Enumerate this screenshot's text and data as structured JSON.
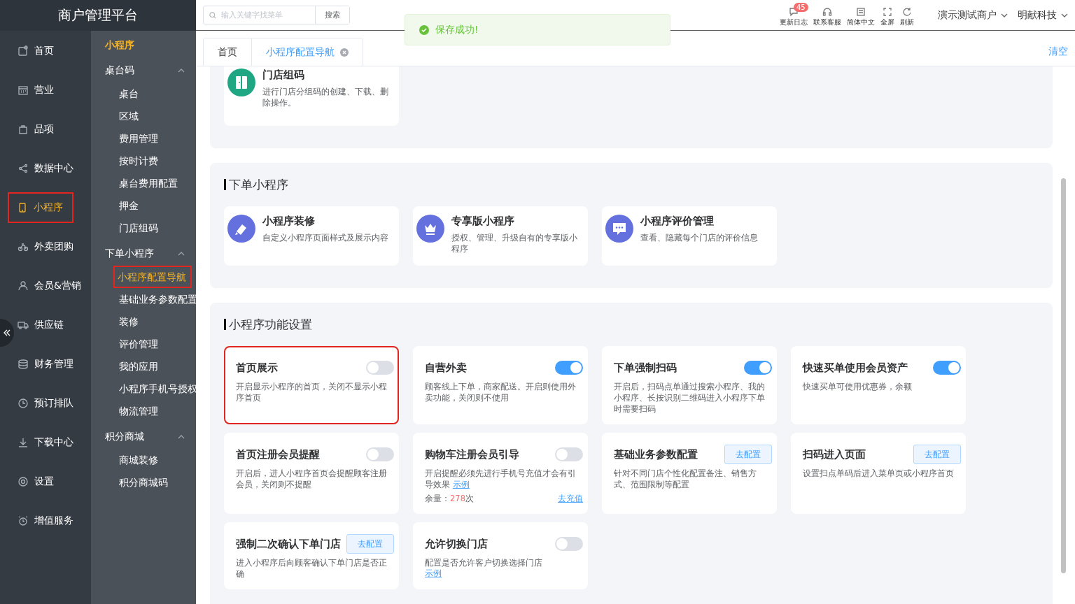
{
  "brand": {
    "title": "商户管理平台"
  },
  "search": {
    "placeholder": "输入关键字找菜单",
    "button": "搜索"
  },
  "toast": {
    "message": "保存成功!"
  },
  "tools": [
    {
      "label": "更新日志",
      "badge": "45"
    },
    {
      "label": "联系客服"
    },
    {
      "label": "简体中文"
    },
    {
      "label": "全屏"
    },
    {
      "label": "刷新"
    }
  ],
  "account_menus": [
    "演示测试商户",
    "明献科技"
  ],
  "nav": {
    "items": [
      {
        "label": "首页",
        "selected": false,
        "highlighted": false
      },
      {
        "label": "营业",
        "selected": false,
        "highlighted": false
      },
      {
        "label": "品项",
        "selected": false,
        "highlighted": false
      },
      {
        "label": "数据中心",
        "selected": false,
        "highlighted": false
      },
      {
        "label": "小程序",
        "selected": true,
        "highlighted": true
      },
      {
        "label": "外卖团购",
        "selected": false,
        "highlighted": false
      },
      {
        "label": "会员&营销",
        "selected": false,
        "highlighted": false
      },
      {
        "label": "供应链",
        "selected": false,
        "highlighted": false
      },
      {
        "label": "财务管理",
        "selected": false,
        "highlighted": false
      },
      {
        "label": "预订排队",
        "selected": false,
        "highlighted": false
      },
      {
        "label": "下载中心",
        "selected": false,
        "highlighted": false
      },
      {
        "label": "设置",
        "selected": false,
        "highlighted": false
      },
      {
        "label": "增值服务",
        "selected": false,
        "highlighted": false
      }
    ]
  },
  "subnav": {
    "title": "小程序",
    "groups": [
      {
        "label": "桌台码",
        "expanded": true,
        "children": [
          {
            "label": "桌台",
            "selected": false,
            "highlighted": false
          },
          {
            "label": "区域",
            "selected": false,
            "highlighted": false
          },
          {
            "label": "费用管理",
            "selected": false,
            "highlighted": false
          },
          {
            "label": "按时计费",
            "selected": false,
            "highlighted": false
          },
          {
            "label": "桌台费用配置",
            "selected": false,
            "highlighted": false
          },
          {
            "label": "押金",
            "selected": false,
            "highlighted": false
          },
          {
            "label": "门店组码",
            "selected": false,
            "highlighted": false
          }
        ]
      },
      {
        "label": "下单小程序",
        "expanded": true,
        "children": [
          {
            "label": "小程序配置导航",
            "selected": true,
            "highlighted": true
          },
          {
            "label": "基础业务参数配置",
            "selected": false,
            "highlighted": false
          },
          {
            "label": "装修",
            "selected": false,
            "highlighted": false
          },
          {
            "label": "评价管理",
            "selected": false,
            "highlighted": false
          },
          {
            "label": "我的应用",
            "selected": false,
            "highlighted": false
          },
          {
            "label": "小程序手机号授权",
            "selected": false,
            "highlighted": false
          },
          {
            "label": "物流管理",
            "selected": false,
            "highlighted": false
          }
        ]
      },
      {
        "label": "积分商城",
        "expanded": true,
        "children": [
          {
            "label": "商城装修",
            "selected": false,
            "highlighted": false
          },
          {
            "label": "积分商城码",
            "selected": false,
            "highlighted": false
          }
        ]
      }
    ]
  },
  "tabs": [
    {
      "label": "首页",
      "selected": false,
      "closable": false
    },
    {
      "label": "小程序配置导航",
      "selected": true,
      "closable": true
    }
  ],
  "clear_action": "清空",
  "sections": [
    {
      "cards": [
        {
          "title": "门店组码",
          "description": "进行门店分组码的创建、下载、删除操作。",
          "color": "#1fa783"
        }
      ]
    },
    {
      "title": "下单小程序",
      "cards": [
        {
          "title": "小程序装修",
          "description": "自定义小程序页面样式及展示内容",
          "color": "#6470de"
        },
        {
          "title": "专享版小程序",
          "description": "授权、管理、升级自有的专享版小程序",
          "color": "#6470de"
        },
        {
          "title": "小程序评价管理",
          "description": "查看、隐藏每个门店的评价信息",
          "color": "#6470de"
        }
      ]
    }
  ],
  "feature_section": {
    "title": "小程序功能设置",
    "features": [
      {
        "kind": "toggle",
        "title": "首页展示",
        "on": false,
        "highlighted": true,
        "description": "开启显示小程序的首页，关闭不显示小程序首页"
      },
      {
        "kind": "toggle",
        "title": "自营外卖",
        "on": true,
        "highlighted": false,
        "description": "顾客线上下单，商家配送。开启则使用外卖功能，关闭则不使用"
      },
      {
        "kind": "toggle",
        "title": "下单强制扫码",
        "on": true,
        "highlighted": false,
        "description": "开启后，扫码点单通过搜索小程序、我的小程序、长按识别二维码进入小程序下单时需要扫码"
      },
      {
        "kind": "toggle",
        "title": "快速买单使用会员资产",
        "on": true,
        "highlighted": false,
        "description": "快速买单可使用优惠券，余额"
      },
      {
        "kind": "toggle",
        "title": "首页注册会员提醒",
        "on": false,
        "highlighted": false,
        "description": "开启后，进人小程序首页会提醒顾客注册会员，关闭则不提醒"
      },
      {
        "kind": "toggle",
        "title": "购物车注册会员引导",
        "on": false,
        "highlighted": false,
        "description": "开启提醒必须先进行手机号充值才会有引导效果",
        "link": "示例",
        "quota": {
          "label": "余量：",
          "value": "278",
          "unit": "次",
          "action": "去充值"
        }
      },
      {
        "kind": "config",
        "title": "基础业务参数配置",
        "button": "去配置",
        "highlighted": false,
        "description": "针对不同门店个性化配置备注、销售方式、范围限制等配置"
      },
      {
        "kind": "config",
        "title": "扫码进入页面",
        "button": "去配置",
        "highlighted": false,
        "description": "设置扫点单码后进入菜单页或小程序首页"
      },
      {
        "kind": "config",
        "title": "强制二次确认下单门店",
        "button": "去配置",
        "highlighted": false,
        "description": "进入小程序后向顾客确认下单门店是否正确"
      },
      {
        "kind": "toggle",
        "title": "允许切换门店",
        "on": false,
        "highlighted": false,
        "description": "配置是否允许客户切换选择门店",
        "link": "示例",
        "link_block": true
      }
    ]
  }
}
